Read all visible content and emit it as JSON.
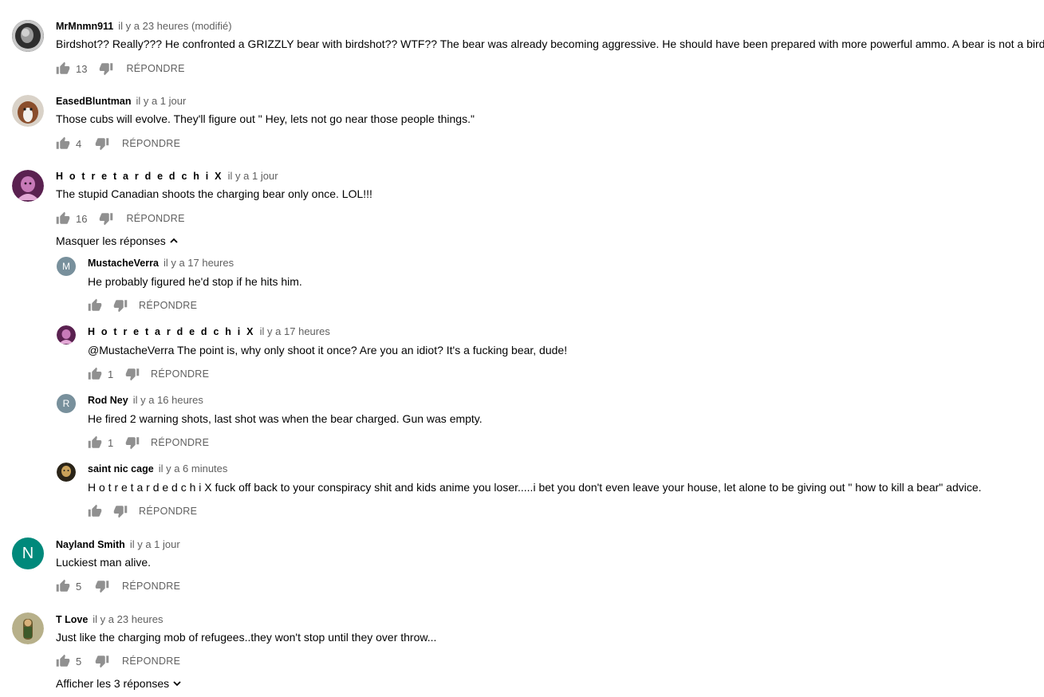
{
  "reply_label": "RÉPONDRE",
  "comments": [
    {
      "author": "MrMnmn911",
      "time": "il y a 23 heures (modifié)",
      "text": "Birdshot?? Really??? He confronted a GRIZZLY bear with birdshot?? WTF?? The bear was already becoming aggressive. He should have been prepared with more powerful ammo. A bear is not a bird.",
      "likes": "13",
      "avatar_color": "#3a3a3a"
    },
    {
      "author": "EasedBluntman",
      "time": "il y a 1 jour",
      "text": "Those cubs will evolve. They'll figure out \" Hey, lets not go near those people things.\"",
      "likes": "4",
      "avatar_color": "#8a5a3c"
    },
    {
      "author": "H o t r e t a r d e d c h i X",
      "time": "il y a 1 jour",
      "text": "The stupid Canadian shoots the charging bear only once. LOL!!!",
      "likes": "16",
      "avatar_color": "#8b3a7a"
    },
    {
      "author": "Nayland Smith",
      "time": "il y a 1 jour",
      "text": "Luckiest man alive.",
      "likes": "5",
      "avatar_color": "#00897b",
      "avatar_letter": "N"
    },
    {
      "author": "T Love",
      "time": "il y a 23 heures",
      "text": "Just like the charging mob of refugees..they won't stop until they over throw...",
      "likes": "5",
      "avatar_color": "#7d7a4a"
    }
  ],
  "hide_replies": "Masquer les réponses",
  "replies": [
    {
      "author": "MustacheVerra",
      "time": "il y a 17 heures",
      "text": "He probably figured he'd stop if he hits him.",
      "likes": "",
      "avatar_color": "#78909c",
      "avatar_letter": "M"
    },
    {
      "author": "H o t r e t a r d e d c h i X",
      "time": "il y a 17 heures",
      "text": "@MustacheVerra The point is, why only shoot it once? Are you an idiot? It's a fucking bear, dude!",
      "likes": "1",
      "avatar_color": "#8b3a7a"
    },
    {
      "author": "Rod Ney",
      "time": "il y a 16 heures",
      "text": "He fired 2 warning shots, last shot was when the bear charged. Gun was empty.",
      "likes": "1",
      "avatar_color": "#78909c",
      "avatar_letter": "R"
    },
    {
      "author": "saint nic cage",
      "time": "il y a 6 minutes",
      "text": "H o t r e t a r d e d c h i X fuck off back to your conspiracy shit and kids anime you loser.....i bet you don't even leave your house, let alone to be giving out \" how to kill a bear\" advice.",
      "likes": "",
      "avatar_color": "#b08a3a"
    }
  ],
  "show_replies": "Afficher les 3 réponses"
}
